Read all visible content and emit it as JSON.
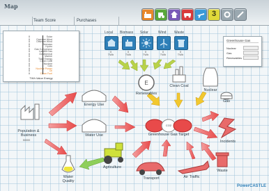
{
  "header": {
    "logo": "Map",
    "tabs": [
      "",
      "Team Score",
      "Purchases"
    ],
    "toolbar": [
      {
        "name": "factory-icon",
        "color": "#e8872a"
      },
      {
        "name": "tractor-icon",
        "color": "#5aa83a"
      },
      {
        "name": "house-icon",
        "color": "#7a5ab8"
      },
      {
        "name": "car-icon",
        "color": "#d83a3a"
      },
      {
        "name": "plane-icon",
        "color": "#3a9ad8"
      },
      {
        "name": "level-3",
        "label": "3",
        "color": "#e0d83a"
      },
      {
        "name": "settings-icon",
        "color": "#8a9aa4"
      },
      {
        "name": "tools-icon",
        "color": "#8a9aa4"
      }
    ]
  },
  "left_panel": {
    "rows": [
      {
        "label": "Solar",
        "value": "0"
      },
      {
        "label": "Onshore Wind",
        "value": "0"
      },
      {
        "label": "Offshore Wind",
        "value": "0"
      },
      {
        "label": "Biomass",
        "value": "0"
      },
      {
        "label": "Hydro",
        "value": "0"
      },
      {
        "label": "Gas Conversion",
        "value": "0"
      },
      {
        "label": "Landfill Gas",
        "value": "0"
      },
      {
        "label": "Geothermal",
        "value": "0"
      },
      {
        "label": "Marine",
        "value": "0"
      },
      {
        "label": "Tidal Energy",
        "value": "0"
      },
      {
        "label": "Clean Coal",
        "value": "0"
      },
      {
        "label": "Nuclear",
        "value": "0"
      },
      {
        "label": "Gas",
        "value": "0"
      },
      {
        "label": "Nuclear Power",
        "value": "0"
      },
      {
        "label": "Oil",
        "value": "0"
      },
      {
        "label": "Clean Fuel",
        "value": "0"
      }
    ],
    "footer": "TWh Value Energy"
  },
  "sources": [
    {
      "label": "Local",
      "value": "0",
      "unit": "TWh",
      "icon": "local-icon"
    },
    {
      "label": "Biomass",
      "value": "0",
      "unit": "TWh",
      "icon": "biomass-icon"
    },
    {
      "label": "Solar",
      "value": "0",
      "unit": "TWh",
      "icon": "solar-icon"
    },
    {
      "label": "Wind",
      "value": "0",
      "unit": "TWh",
      "icon": "wind-icon"
    },
    {
      "label": "Waste",
      "value": "0",
      "unit": "TWh",
      "icon": "waste-icon"
    }
  ],
  "right_panel": {
    "title": "Greenhouse Gas",
    "rows": [
      "Nuclear",
      "Gas",
      "Renewables"
    ]
  },
  "nodes": {
    "population": "Population & Business",
    "population_sub": "50000",
    "energy_use": "Energy Use",
    "water_use": "Water Use",
    "renewables": "Renewables",
    "clean_coal": "Clean Coal",
    "nuclear": "Nuclear",
    "gas": "Gas",
    "ghg_target": "Greenhouse Gas Target",
    "co2": "CO2",
    "incidents": "Incidents",
    "agriculture": "Agriculture",
    "water_quality": "Water Quality",
    "transport": "Transport",
    "air_traffic": "Air Traffic",
    "waste": "Waste"
  },
  "footer_logo": "PowerCASTLE"
}
